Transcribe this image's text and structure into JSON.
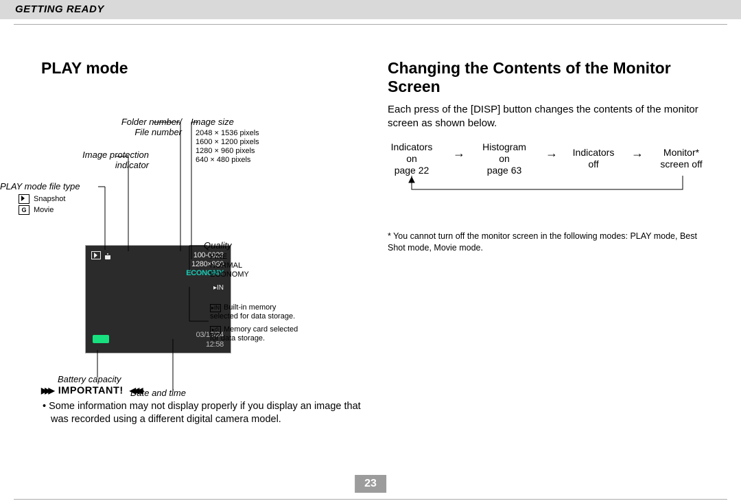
{
  "header": {
    "section": "GETTING READY"
  },
  "page_number": "23",
  "left": {
    "title": "PLAY mode",
    "labels": {
      "folder_file": "Folder number/\nFile number",
      "img_prot": "Image protection\nindicator",
      "filetype": "PLAY mode file type",
      "filetype_items": [
        "Snapshot",
        "Movie"
      ],
      "img_size": "Image size",
      "img_size_items": [
        "2048 × 1536 pixels",
        "1600 × 1200 pixels",
        "1280 ×   960 pixels",
        "  640 ×   480 pixels"
      ],
      "quality": "Quality",
      "quality_items": [
        "FINE",
        "NORMAL",
        "ECONOMY"
      ],
      "storage_items": [
        "Built-in memory selected for data storage.",
        "Memory card selected for data storage."
      ],
      "battery": "Battery capacity",
      "datetime": "Date and time"
    },
    "lcd": {
      "fileno": "100-0023",
      "size": "1280×960",
      "quality": "ECONOMY",
      "date": "03/12/24",
      "time": "12:58"
    },
    "important": {
      "heading": "IMPORTANT!",
      "bullet": "Some information may not display properly if you display an image that was recorded using a different digital camera model."
    }
  },
  "right": {
    "title": "Changing the Contents of the Monitor Screen",
    "intro": "Each press of the [DISP] button changes the contents of the monitor screen as shown below.",
    "nodes": {
      "n1": "Indicators\non\npage 22",
      "n2": "Histogram\non\npage 63",
      "n3": "Indicators\noff",
      "n4": "Monitor*\nscreen off"
    },
    "footnote": "* You cannot turn off the monitor screen in the following modes: PLAY mode, Best Shot mode, Movie mode."
  }
}
